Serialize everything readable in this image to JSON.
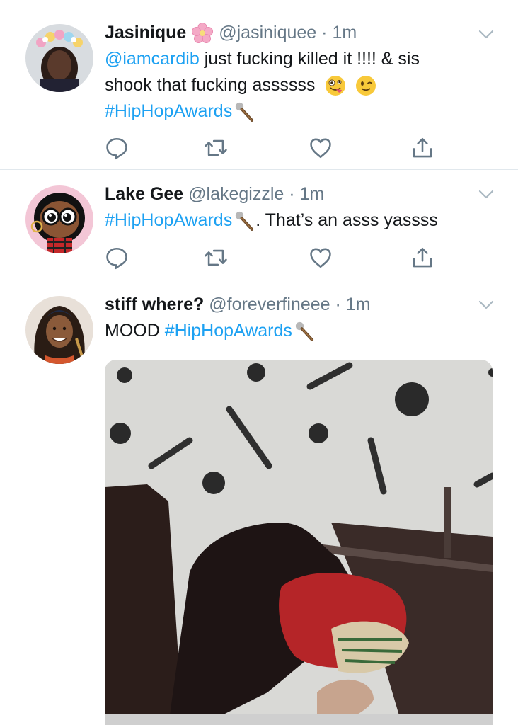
{
  "tweets": [
    {
      "name": "Jasinique",
      "handle": "@jasiniquee",
      "dot": "·",
      "time": "1m",
      "mention": "@iamcardib",
      "text_line1": " just fucking killed it !!!! & sis",
      "text_line2": "shook that fucking assssss",
      "hashtag": "#HipHopAwards",
      "emojis": [
        "cherry-blossom-icon",
        "zany-face-icon",
        "winking-face-icon",
        "microphone-icon"
      ]
    },
    {
      "name": "Lake Gee",
      "handle": "@lakegizzle",
      "dot": "·",
      "time": "1m",
      "hashtag": "#HipHopAwards",
      "text_after": ". That’s an asss yassss",
      "emojis": [
        "microphone-icon"
      ]
    },
    {
      "name": "stiff where?",
      "handle": "@foreverfineee",
      "dot": "·",
      "time": "1m",
      "text_before": "MOOD ",
      "hashtag": "#HipHopAwards",
      "emojis": [
        "microphone-icon"
      ],
      "media": "gif-image"
    }
  ],
  "actions": [
    "reply-icon",
    "retweet-icon",
    "like-icon",
    "share-icon"
  ],
  "colors": {
    "link": "#1da1f2",
    "secondary": "#657786",
    "divider": "#e1e8ed"
  }
}
